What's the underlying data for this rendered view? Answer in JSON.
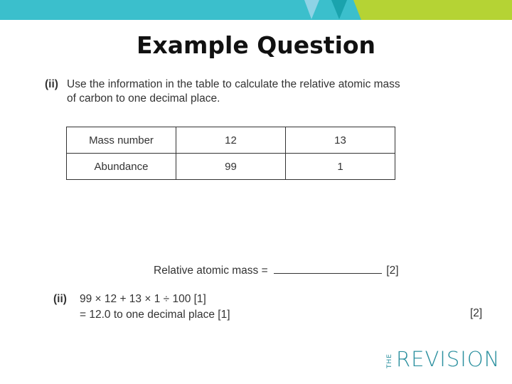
{
  "header": {
    "colors": {
      "teal": "#3bbfcc",
      "light_blue": "#8fd3e6",
      "dark_teal": "#1aa3ad",
      "lime": "#b5d334"
    }
  },
  "title": "Example Question",
  "question": {
    "number": "(ii)",
    "text": "Use the information in the table to calculate the relative atomic mass of carbon to one decimal place."
  },
  "table": {
    "rows": [
      {
        "label": "Mass number",
        "values": [
          "12",
          "13"
        ]
      },
      {
        "label": "Abundance",
        "values": [
          "99",
          "1"
        ]
      }
    ]
  },
  "answer": {
    "label": "Relative atomic mass",
    "equals": "=",
    "marks": "[2]"
  },
  "mark_scheme": {
    "number": "(ii)",
    "lines": [
      "99 × 12 + 13 × 1 ÷ 100 [1]",
      "= 12.0 to one decimal place [1]"
    ],
    "total": "[2]"
  },
  "logo": {
    "prefix": "THE",
    "word": "REVISION",
    "color": "#2a8f9e"
  }
}
